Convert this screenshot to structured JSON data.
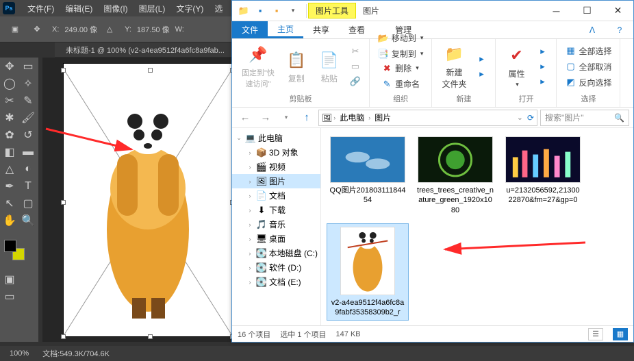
{
  "photoshop": {
    "logo": "Ps",
    "menu": [
      "文件(F)",
      "编辑(E)",
      "图像(I)",
      "图层(L)",
      "文字(Y)",
      "选"
    ],
    "options": {
      "x_label": "X:",
      "x_value": "249.00 像",
      "y_label": "Y:",
      "y_value": "187.50 像",
      "w_label": "W:"
    },
    "doc_tab": "未标题-1 @ 100% (v2-a4ea9512f4a6fc8a9fab...",
    "zoom": "100%",
    "docinfo": "文档:549.3K/704.6K"
  },
  "explorer": {
    "titlebar": {
      "context_tab": "图片工具",
      "title": "图片"
    },
    "ribbon_tabs": {
      "file": "文件",
      "home": "主页",
      "share": "共享",
      "view": "查看",
      "manage": "管理"
    },
    "ribbon": {
      "pin": "固定到\"快\n速访问\"",
      "copy": "复制",
      "paste": "粘贴",
      "clipboard_group": "剪贴板",
      "move_to": "移动到",
      "copy_to": "复制到",
      "delete": "删除",
      "rename": "重命名",
      "organize_group": "组织",
      "new_folder": "新建\n文件夹",
      "new_group": "新建",
      "properties": "属性",
      "open_group": "打开",
      "select_all": "全部选择",
      "select_none": "全部取消",
      "select_invert": "反向选择",
      "select_group": "选择"
    },
    "address": {
      "pc": "此电脑",
      "folder": "图片",
      "search_placeholder": "搜索\"图片\""
    },
    "tree": [
      {
        "label": "此电脑",
        "icon": "💻",
        "depth": 0,
        "expanded": true
      },
      {
        "label": "3D 对象",
        "icon": "📦",
        "depth": 1
      },
      {
        "label": "视频",
        "icon": "🎬",
        "depth": 1
      },
      {
        "label": "图片",
        "icon": "🖼",
        "depth": 1,
        "selected": true
      },
      {
        "label": "文档",
        "icon": "📄",
        "depth": 1
      },
      {
        "label": "下载",
        "icon": "⬇",
        "depth": 1
      },
      {
        "label": "音乐",
        "icon": "🎵",
        "depth": 1
      },
      {
        "label": "桌面",
        "icon": "🖥",
        "depth": 1
      },
      {
        "label": "本地磁盘 (C:)",
        "icon": "💽",
        "depth": 1
      },
      {
        "label": "软件 (D:)",
        "icon": "💽",
        "depth": 1
      },
      {
        "label": "文档 (E:)",
        "icon": "💽",
        "depth": 1
      }
    ],
    "files": [
      {
        "name": "QQ图片20180311184454",
        "kind": "dolphins"
      },
      {
        "name": "trees_trees_creative_nature_green_1920x1080",
        "kind": "tree"
      },
      {
        "name": "u=2132056592,2130022870&fm=27&gp=0",
        "kind": "city"
      },
      {
        "name": "v2-a4ea9512f4a6fc8a9fabf35358309b2_r",
        "kind": "panda",
        "selected": true
      }
    ],
    "status": {
      "items": "16 个项目",
      "selected": "选中 1 个项目",
      "size": "147 KB"
    }
  }
}
